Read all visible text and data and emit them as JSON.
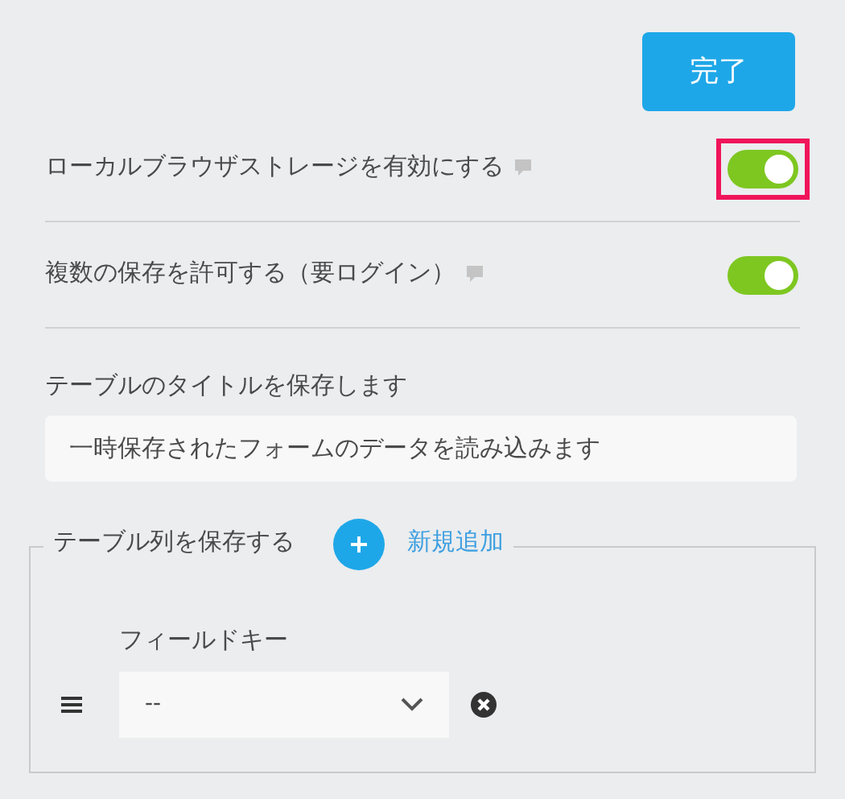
{
  "done_button": "完了",
  "toggles": [
    {
      "label": "ローカルブラウザストレージを有効にする",
      "on": true,
      "highlighted": true
    },
    {
      "label": "複数の保存を許可する（要ログイン）",
      "on": true,
      "highlighted": false
    }
  ],
  "title_field": {
    "label": "テーブルのタイトルを保存します",
    "value": "一時保存されたフォームのデータを読み込みます"
  },
  "columns_section": {
    "legend": "テーブル列を保存する",
    "add_link": "新規追加",
    "field_label": "フィールドキー",
    "rows": [
      {
        "value": "--"
      }
    ]
  }
}
